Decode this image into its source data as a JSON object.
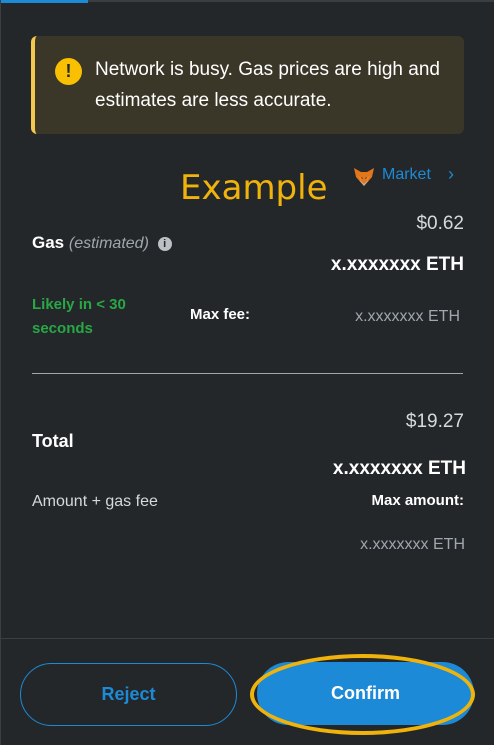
{
  "alert": {
    "icon": "warning-icon",
    "message": "Network is busy. Gas prices are high and estimates are less accurate."
  },
  "annotation": {
    "label": "Example",
    "color": "#f0b30c"
  },
  "market": {
    "label": "Market",
    "icon": "fox-icon",
    "chevron": "›"
  },
  "gas": {
    "label": "Gas",
    "estimated": "(estimated)",
    "fiat": "$0.62",
    "eth": "x.xxxxxxx ETH",
    "likely": "Likely in < 30 seconds",
    "max_fee_label": "Max fee:",
    "max_fee_value": "x.xxxxxxx ETH"
  },
  "total": {
    "label": "Total",
    "fiat": "$19.27",
    "eth": "x.xxxxxxx ETH",
    "subtitle": "Amount + gas fee",
    "max_amount_label": "Max amount:",
    "max_amount_value": "x.xxxxxxx ETH"
  },
  "actions": {
    "reject": "Reject",
    "confirm": "Confirm"
  },
  "colors": {
    "background": "#24272a",
    "accent": "#1c8ad6",
    "warning": "#f8c000",
    "success": "#28a745"
  }
}
